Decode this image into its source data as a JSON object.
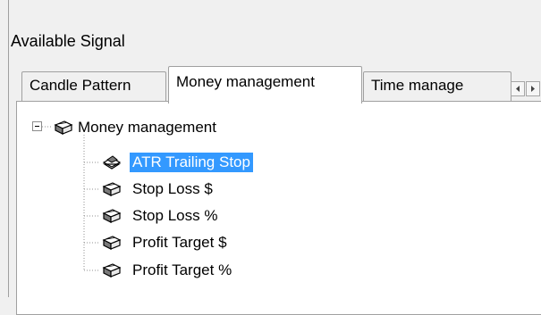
{
  "group": {
    "title": "Available Signal"
  },
  "tabs": [
    {
      "label": "Candle Pattern",
      "active": false
    },
    {
      "label": "Money management",
      "active": true
    },
    {
      "label": "Time manage",
      "active": false
    }
  ],
  "tab_scroll": {
    "left_icon": "arrow-left-icon",
    "right_icon": "arrow-right-icon"
  },
  "tree": {
    "root": {
      "label": "Money management",
      "expanded": true,
      "icon": "book-icon"
    },
    "children": [
      {
        "label": "ATR Trailing Stop",
        "selected": true,
        "icon": "open-book-icon"
      },
      {
        "label": "Stop Loss $",
        "selected": false,
        "icon": "book-icon"
      },
      {
        "label": "Stop Loss %",
        "selected": false,
        "icon": "book-icon"
      },
      {
        "label": "Profit Target $",
        "selected": false,
        "icon": "book-icon"
      },
      {
        "label": "Profit Target %",
        "selected": false,
        "icon": "book-icon"
      }
    ]
  },
  "colors": {
    "selection": "#3399ff",
    "border": "#a0a0a0",
    "background": "#f0f0f0"
  }
}
